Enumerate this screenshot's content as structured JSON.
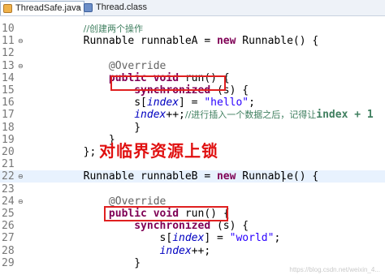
{
  "tabs": [
    {
      "label": "ThreadSafe.java",
      "close": "×",
      "icon": "java-file-icon"
    },
    {
      "label": "Thread.class",
      "icon": "class-file-icon"
    }
  ],
  "lines": [
    {
      "n": "10",
      "seg": [
        {
          "t": "        "
        },
        {
          "t": "//创建两个操作",
          "c": "cmt"
        }
      ]
    },
    {
      "n": "11",
      "seg": [
        {
          "t": "        Runnable runnableA = "
        },
        {
          "t": "new",
          "c": "kw"
        },
        {
          "t": " Runnable() {"
        }
      ]
    },
    {
      "n": "12",
      "seg": [
        {
          "t": ""
        }
      ]
    },
    {
      "n": "13",
      "seg": [
        {
          "t": "            "
        },
        {
          "t": "@Override",
          "c": "ann"
        }
      ]
    },
    {
      "n": "14",
      "seg": [
        {
          "t": "            "
        },
        {
          "t": "public",
          "c": "kw"
        },
        {
          "t": " "
        },
        {
          "t": "void",
          "c": "kw"
        },
        {
          "t": " run() {"
        }
      ]
    },
    {
      "n": "15",
      "seg": [
        {
          "t": "                "
        },
        {
          "t": "synchronized",
          "c": "kw"
        },
        {
          "t": " (s) {"
        }
      ]
    },
    {
      "n": "16",
      "seg": [
        {
          "t": "                s["
        },
        {
          "t": "index",
          "c": "var"
        },
        {
          "t": "] = "
        },
        {
          "t": "\"hello\"",
          "c": "str"
        },
        {
          "t": ";"
        }
      ]
    },
    {
      "n": "17",
      "seg": [
        {
          "t": "                "
        },
        {
          "t": "index",
          "c": "var"
        },
        {
          "t": "++;"
        },
        {
          "t": "//进行插入一个数据之后，记得让",
          "c": "cmt"
        },
        {
          "t": "index + 1",
          "c": "cmt-b"
        }
      ]
    },
    {
      "n": "18",
      "seg": [
        {
          "t": "                }"
        }
      ]
    },
    {
      "n": "19",
      "seg": [
        {
          "t": "            }"
        }
      ]
    },
    {
      "n": "20",
      "seg": [
        {
          "t": "        };"
        }
      ]
    },
    {
      "n": "21",
      "seg": [
        {
          "t": ""
        }
      ]
    },
    {
      "n": "22",
      "seg": [
        {
          "t": "        Runnable runnableB = "
        },
        {
          "t": "new",
          "c": "kw"
        },
        {
          "t": " Runnable() {"
        }
      ]
    },
    {
      "n": "23",
      "seg": [
        {
          "t": ""
        }
      ]
    },
    {
      "n": "24",
      "seg": [
        {
          "t": "            "
        },
        {
          "t": "@Override",
          "c": "ann"
        }
      ]
    },
    {
      "n": "25",
      "seg": [
        {
          "t": "            "
        },
        {
          "t": "public",
          "c": "kw"
        },
        {
          "t": " "
        },
        {
          "t": "void",
          "c": "kw"
        },
        {
          "t": " run() {"
        }
      ]
    },
    {
      "n": "26",
      "seg": [
        {
          "t": "                "
        },
        {
          "t": "synchronized",
          "c": "kw"
        },
        {
          "t": " (s) {"
        }
      ]
    },
    {
      "n": "27",
      "seg": [
        {
          "t": "                    s["
        },
        {
          "t": "index",
          "c": "var"
        },
        {
          "t": "] = "
        },
        {
          "t": "\"world\"",
          "c": "str"
        },
        {
          "t": ";"
        }
      ]
    },
    {
      "n": "28",
      "seg": [
        {
          "t": "                    "
        },
        {
          "t": "index",
          "c": "var"
        },
        {
          "t": "++;"
        }
      ]
    },
    {
      "n": "29",
      "seg": [
        {
          "t": "                }"
        }
      ]
    }
  ],
  "annotation": "对临界资源上锁",
  "watermark": "https://blog.csdn.net/weixin_4..."
}
